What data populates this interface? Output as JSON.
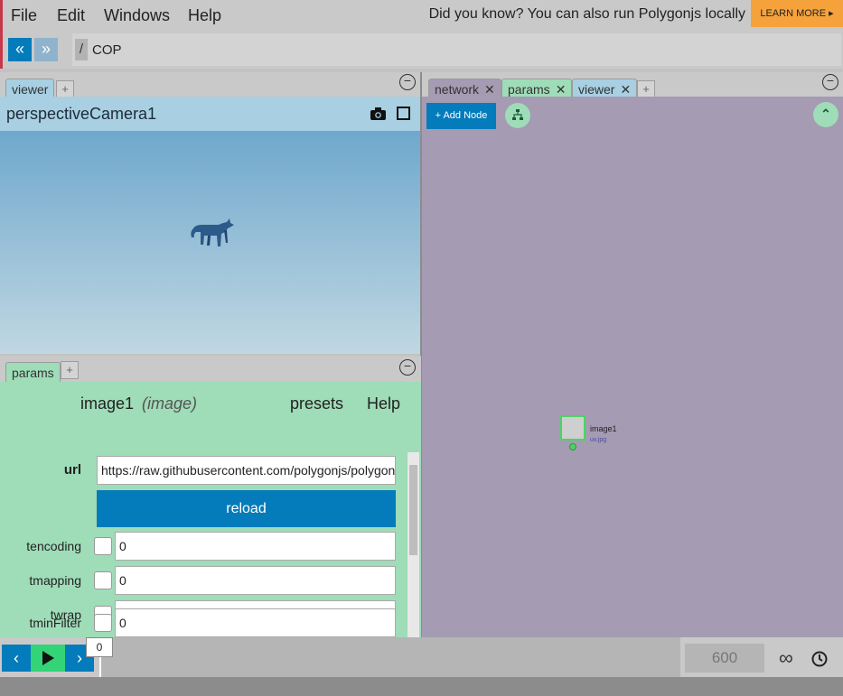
{
  "menu": {
    "file": "File",
    "edit": "Edit",
    "windows": "Windows",
    "help": "Help",
    "tip": "Did you know? You can also run Polygonjs locally",
    "learn_more": "LEARN MORE ▸"
  },
  "path": {
    "slash": "/",
    "current": "COP"
  },
  "viewer": {
    "tab": "viewer",
    "camera": "perspectiveCamera1"
  },
  "params": {
    "tab": "params",
    "node_name": "image1",
    "node_type": "(image)",
    "presets": "presets",
    "help": "Help",
    "url_label": "url",
    "url_value": "https://raw.githubusercontent.com/polygonjs/polygonjs-assets/master/textures/uv.jpg",
    "reload": "reload",
    "fields": [
      {
        "label": "tencoding",
        "value": "0"
      },
      {
        "label": "tmapping",
        "value": "0"
      },
      {
        "label": "twrap",
        "value": "0"
      },
      {
        "label": "tminFilter",
        "value": "0"
      }
    ]
  },
  "network": {
    "tabs": [
      "network",
      "params",
      "viewer"
    ],
    "add_node": "+ Add Node",
    "node": {
      "name": "image1",
      "sub": "uv.jpg"
    }
  },
  "timeline": {
    "current_frame": "0",
    "end_frame": "600"
  },
  "colors": {
    "accent_blue": "#047bba",
    "params_green": "#9fdcb8",
    "network_purple": "#a59bb3",
    "learn_more_orange": "#f6a23c"
  }
}
